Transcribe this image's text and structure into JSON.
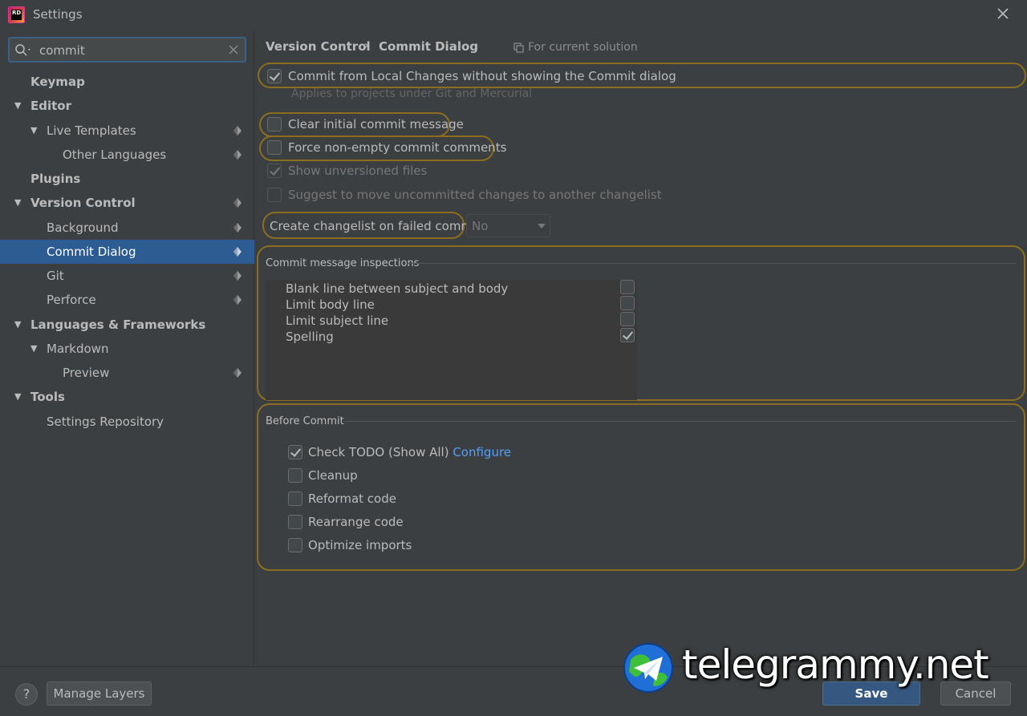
{
  "window": {
    "title": "Settings"
  },
  "search": {
    "value": "commit"
  },
  "tree": [
    {
      "label": "Keymap"
    },
    {
      "label": "Editor"
    },
    {
      "label": "Live Templates"
    },
    {
      "label": "Other Languages"
    },
    {
      "label": "Plugins"
    },
    {
      "label": "Version Control"
    },
    {
      "label": "Background"
    },
    {
      "label": "Commit Dialog"
    },
    {
      "label": "Git"
    },
    {
      "label": "Perforce"
    },
    {
      "label": "Languages & Frameworks"
    },
    {
      "label": "Markdown"
    },
    {
      "label": "Preview"
    },
    {
      "label": "Tools"
    },
    {
      "label": "Settings Repository"
    }
  ],
  "breadcrumb": {
    "parent": "Version Control",
    "separator": "›",
    "current": "Commit Dialog",
    "scope": "For current solution"
  },
  "options": {
    "commit_local_changes": {
      "label": "Commit from Local Changes without showing the Commit dialog",
      "checked": true,
      "hint": "Applies to projects under Git and Mercurial"
    },
    "clear_initial": {
      "label": "Clear initial commit message",
      "checked": false
    },
    "force_nonempty": {
      "label": "Force non-empty commit comments",
      "checked": false
    },
    "show_unversioned": {
      "label": "Show unversioned files",
      "checked": true
    },
    "suggest_move": {
      "label": "Suggest to move uncommitted changes to another changelist",
      "checked": false
    },
    "create_changelist": {
      "label": "Create changelist on failed commit:",
      "value": "No"
    }
  },
  "inspections": {
    "title": "Commit message inspections",
    "items": [
      {
        "label": "Blank line between subject and body",
        "checked": false
      },
      {
        "label": "Limit body line",
        "checked": false
      },
      {
        "label": "Limit subject line",
        "checked": false
      },
      {
        "label": "Spelling",
        "checked": true
      }
    ]
  },
  "before_commit": {
    "title": "Before Commit",
    "items": [
      {
        "label": "Check TODO (Show All)",
        "link": "Configure",
        "checked": true
      },
      {
        "label": "Cleanup",
        "checked": false
      },
      {
        "label": "Reformat code",
        "checked": false
      },
      {
        "label": "Rearrange code",
        "checked": false
      },
      {
        "label": "Optimize imports",
        "checked": false
      }
    ]
  },
  "footer": {
    "help": "?",
    "manage_layers": "Manage Layers",
    "save": "Save",
    "cancel": "Cancel"
  },
  "watermark": {
    "text": "telegrammy.net"
  }
}
